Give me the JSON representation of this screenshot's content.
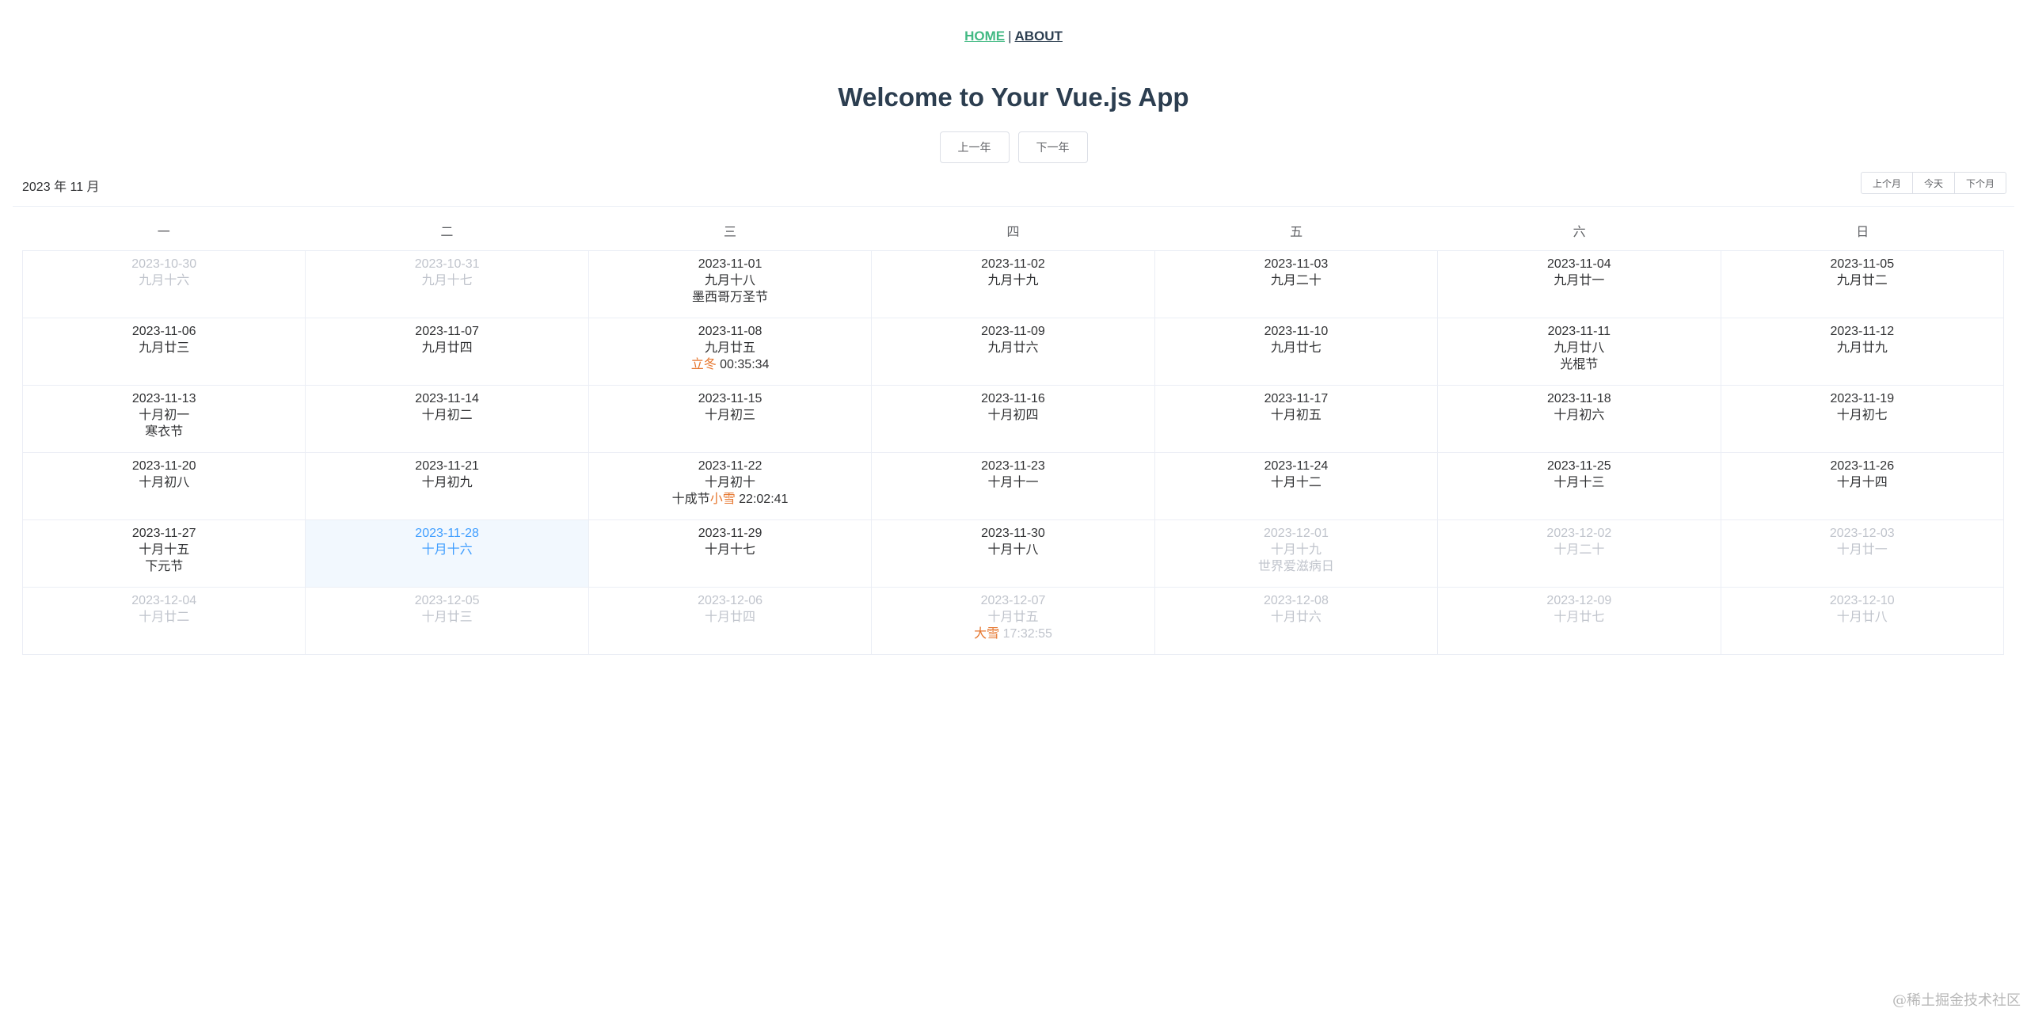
{
  "nav": {
    "home": "HOME",
    "separator": "|",
    "about": "ABOUT"
  },
  "title": "Welcome to Your Vue.js App",
  "year_buttons": {
    "prev": "上一年",
    "next": "下一年"
  },
  "calendar": {
    "month_label": "2023 年 11 月",
    "month_buttons": {
      "prev": "上个月",
      "today": "今天",
      "next": "下个月"
    },
    "weekdays": [
      "一",
      "二",
      "三",
      "四",
      "五",
      "六",
      "日"
    ],
    "days": [
      {
        "date": "2023-10-30",
        "lunar": "九月十六",
        "other": true
      },
      {
        "date": "2023-10-31",
        "lunar": "九月十七",
        "other": true
      },
      {
        "date": "2023-11-01",
        "lunar": "九月十八",
        "festival": "墨西哥万圣节"
      },
      {
        "date": "2023-11-02",
        "lunar": "九月十九"
      },
      {
        "date": "2023-11-03",
        "lunar": "九月二十"
      },
      {
        "date": "2023-11-04",
        "lunar": "九月廿一"
      },
      {
        "date": "2023-11-05",
        "lunar": "九月廿二"
      },
      {
        "date": "2023-11-06",
        "lunar": "九月廿三"
      },
      {
        "date": "2023-11-07",
        "lunar": "九月廿四"
      },
      {
        "date": "2023-11-08",
        "lunar": "九月廿五",
        "term": "立冬",
        "term_time": "00:35:34"
      },
      {
        "date": "2023-11-09",
        "lunar": "九月廿六"
      },
      {
        "date": "2023-11-10",
        "lunar": "九月廿七"
      },
      {
        "date": "2023-11-11",
        "lunar": "九月廿八",
        "festival": "光棍节"
      },
      {
        "date": "2023-11-12",
        "lunar": "九月廿九"
      },
      {
        "date": "2023-11-13",
        "lunar": "十月初一",
        "festival": "寒衣节"
      },
      {
        "date": "2023-11-14",
        "lunar": "十月初二"
      },
      {
        "date": "2023-11-15",
        "lunar": "十月初三"
      },
      {
        "date": "2023-11-16",
        "lunar": "十月初四"
      },
      {
        "date": "2023-11-17",
        "lunar": "十月初五"
      },
      {
        "date": "2023-11-18",
        "lunar": "十月初六"
      },
      {
        "date": "2023-11-19",
        "lunar": "十月初七"
      },
      {
        "date": "2023-11-20",
        "lunar": "十月初八"
      },
      {
        "date": "2023-11-21",
        "lunar": "十月初九"
      },
      {
        "date": "2023-11-22",
        "lunar": "十月初十",
        "festival": "十成节",
        "term": "小雪",
        "term_time": "22:02:41"
      },
      {
        "date": "2023-11-23",
        "lunar": "十月十一"
      },
      {
        "date": "2023-11-24",
        "lunar": "十月十二"
      },
      {
        "date": "2023-11-25",
        "lunar": "十月十三"
      },
      {
        "date": "2023-11-26",
        "lunar": "十月十四"
      },
      {
        "date": "2023-11-27",
        "lunar": "十月十五",
        "festival": "下元节"
      },
      {
        "date": "2023-11-28",
        "lunar": "十月十六",
        "today": true
      },
      {
        "date": "2023-11-29",
        "lunar": "十月十七"
      },
      {
        "date": "2023-11-30",
        "lunar": "十月十八"
      },
      {
        "date": "2023-12-01",
        "lunar": "十月十九",
        "festival": "世界爱滋病日",
        "other": true
      },
      {
        "date": "2023-12-02",
        "lunar": "十月二十",
        "other": true
      },
      {
        "date": "2023-12-03",
        "lunar": "十月廿一",
        "other": true
      },
      {
        "date": "2023-12-04",
        "lunar": "十月廿二",
        "other": true
      },
      {
        "date": "2023-12-05",
        "lunar": "十月廿三",
        "other": true
      },
      {
        "date": "2023-12-06",
        "lunar": "十月廿四",
        "other": true
      },
      {
        "date": "2023-12-07",
        "lunar": "十月廿五",
        "term": "大雪",
        "term_time": "17:32:55",
        "other": true
      },
      {
        "date": "2023-12-08",
        "lunar": "十月廿六",
        "other": true
      },
      {
        "date": "2023-12-09",
        "lunar": "十月廿七",
        "other": true
      },
      {
        "date": "2023-12-10",
        "lunar": "十月廿八",
        "other": true
      }
    ]
  },
  "colors": {
    "nav_active": "#42b983",
    "heading": "#2c3e50",
    "today_text": "#409eff",
    "today_bg": "#f2f8fe",
    "solar_term": "#e6762e",
    "other_month_text": "#c0c4cc"
  },
  "watermark": "@稀土掘金技术社区"
}
